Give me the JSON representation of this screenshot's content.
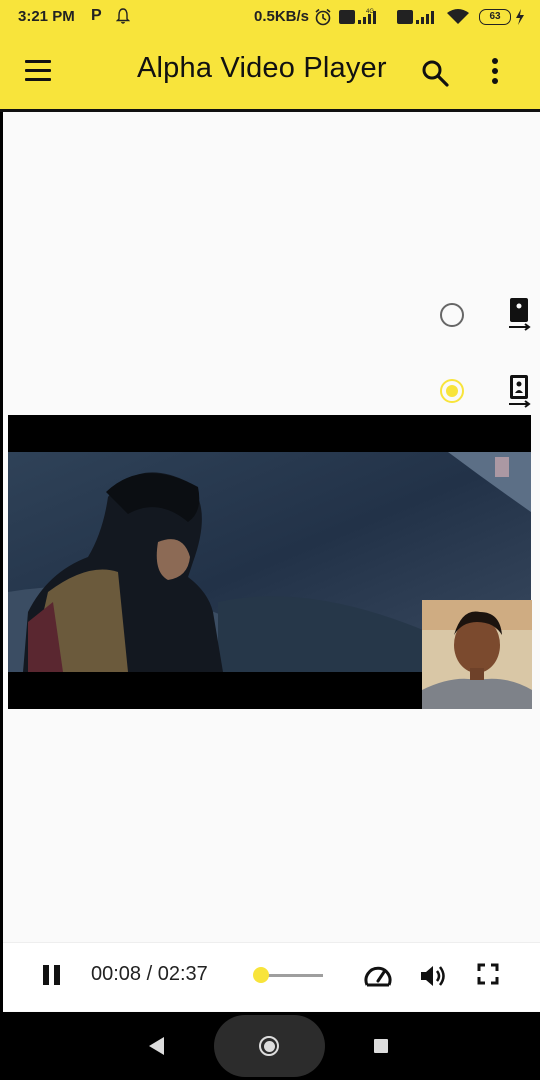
{
  "status_bar": {
    "time": "3:21 PM",
    "p_label": "P",
    "network_speed": "0.5KB/s",
    "battery": "63",
    "icons": [
      "p-icon",
      "bell-icon",
      "alarm-icon",
      "volte-icon",
      "signal-icon",
      "wifi-icon",
      "battery-icon",
      "charging-icon"
    ]
  },
  "app_bar": {
    "title": "Alpha Video Player",
    "icons": [
      "menu-icon",
      "search-icon",
      "overflow-menu-icon"
    ]
  },
  "orientation_options": [
    {
      "icon": "portrait-orientation-icon",
      "selected": false
    },
    {
      "icon": "landscape-orientation-icon",
      "selected": true
    }
  ],
  "player": {
    "current_time": "00:08",
    "duration": "02:37",
    "time_display": "00:08 / 02:37",
    "progress_fraction": 0.05,
    "icons": [
      "pause-icon",
      "playback-speed-icon",
      "volume-icon",
      "fullscreen-icon"
    ]
  },
  "nav_bar": {
    "icons": [
      "back-icon",
      "home-icon",
      "recents-icon"
    ]
  },
  "colors": {
    "accent": "#f8e43b",
    "background": "#fafafa",
    "text": "#111111"
  }
}
